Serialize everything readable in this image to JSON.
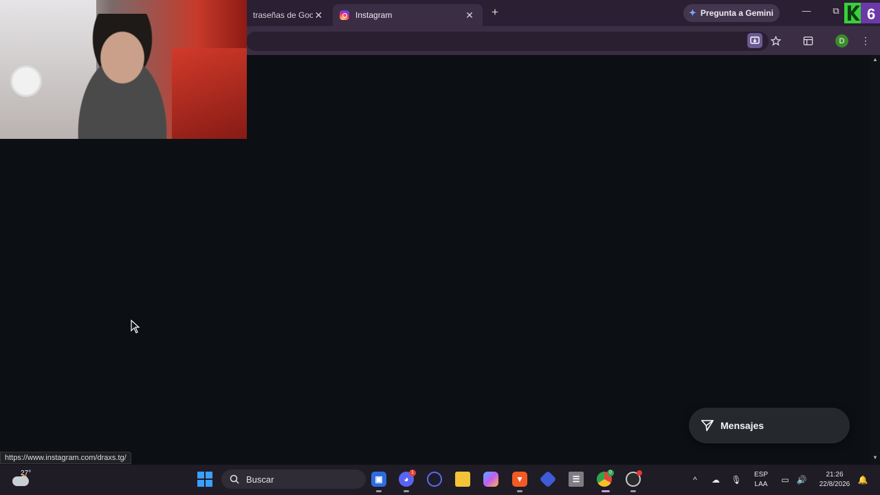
{
  "browser": {
    "tabs": [
      {
        "title": "traseñas de Goog",
        "active": false
      },
      {
        "title": "Instagram",
        "active": true
      }
    ],
    "tab_close_glyph": "✕",
    "new_tab_glyph": "+",
    "gemini_button": "Pregunta a Gemini",
    "window_controls": {
      "minimize": "—",
      "restore": "⧉"
    },
    "profile_initial": "D",
    "toolbar_icons": [
      "install-app-icon",
      "bookmark-star-icon",
      "side-panel-icon",
      "kebab-menu-icon"
    ],
    "status_url": "https://www.instagram.com/draxs.tg/"
  },
  "page": {
    "messages_button": "Mensajes"
  },
  "taskbar": {
    "weather_temp": "27°",
    "search_placeholder": "Buscar",
    "discord_badge": "1",
    "chrome_badge": "0",
    "apps": [
      "roblox-icon",
      "discord-icon",
      "cortana-icon",
      "file-explorer-icon",
      "copilot-icon",
      "brave-icon",
      "vpn-icon",
      "drive-icon",
      "chrome-icon",
      "obs-icon"
    ],
    "tray": {
      "language_line1": "ESP",
      "language_line2": "LAA",
      "time": "21:26",
      "date": "22/8/2026"
    }
  },
  "colors": {
    "page_bg": "#0c1014",
    "tabstrip_bg": "#2b1f33",
    "toolbar_bg": "#3b2d44",
    "taskbar_bg": "#1f1c26",
    "accent_green": "#3c8b2a"
  }
}
